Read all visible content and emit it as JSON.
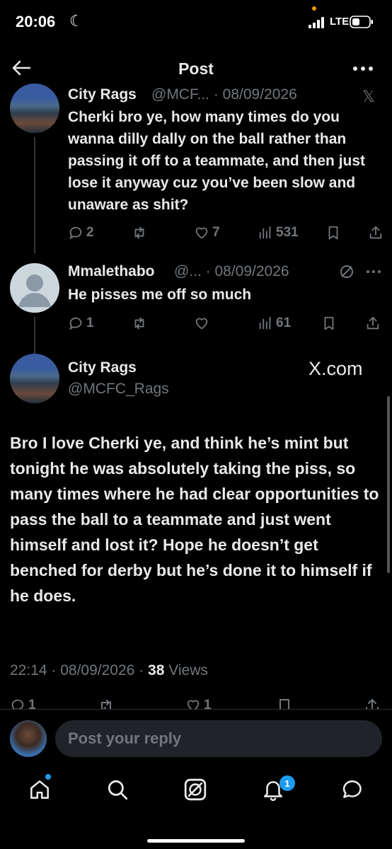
{
  "status_bar": {
    "time": "20:06",
    "network": "LTE"
  },
  "header": {
    "title": "Post"
  },
  "thread": [
    {
      "name": "City Rags",
      "handle_date": "@MCF... · 08/09/2026",
      "text": "Cherki bro ye, how many times do you wanna dilly dally on the ball rather than passing it off to a teammate, and then just lose it anyway cuz you’ve been slow and unaware as shit?",
      "replies": "2",
      "reposts": "",
      "likes": "7",
      "views": "531"
    },
    {
      "name": "Mmalethabo",
      "handle_date": "@... · 08/09/2026",
      "text": "He pisses me off so much",
      "replies": "1",
      "reposts": "",
      "likes": "",
      "views": "61"
    }
  ],
  "main_post": {
    "name": "City Rags",
    "handle": "@MCFC_Rags",
    "watermark": "X.com",
    "text": "Bro I love Cherki ye, and think he’s mint but tonight he was absolutely taking the piss, so many times where he had clear opportunities to pass the ball to a teammate and just went himself and lost it? Hope he doesn’t get benched for derby but he’s done it to himself if he does.",
    "time": "22:14",
    "date": "08/09/2026",
    "views_count": "38",
    "views_label": "Views",
    "replies": "1",
    "likes": "1"
  },
  "reply": {
    "placeholder": "Post your reply"
  },
  "nav": {
    "notification_count": "1"
  },
  "colors": {
    "background": "#000000",
    "text": "#e7e9ea",
    "muted": "#71767b",
    "accent": "#1d9bf0"
  }
}
